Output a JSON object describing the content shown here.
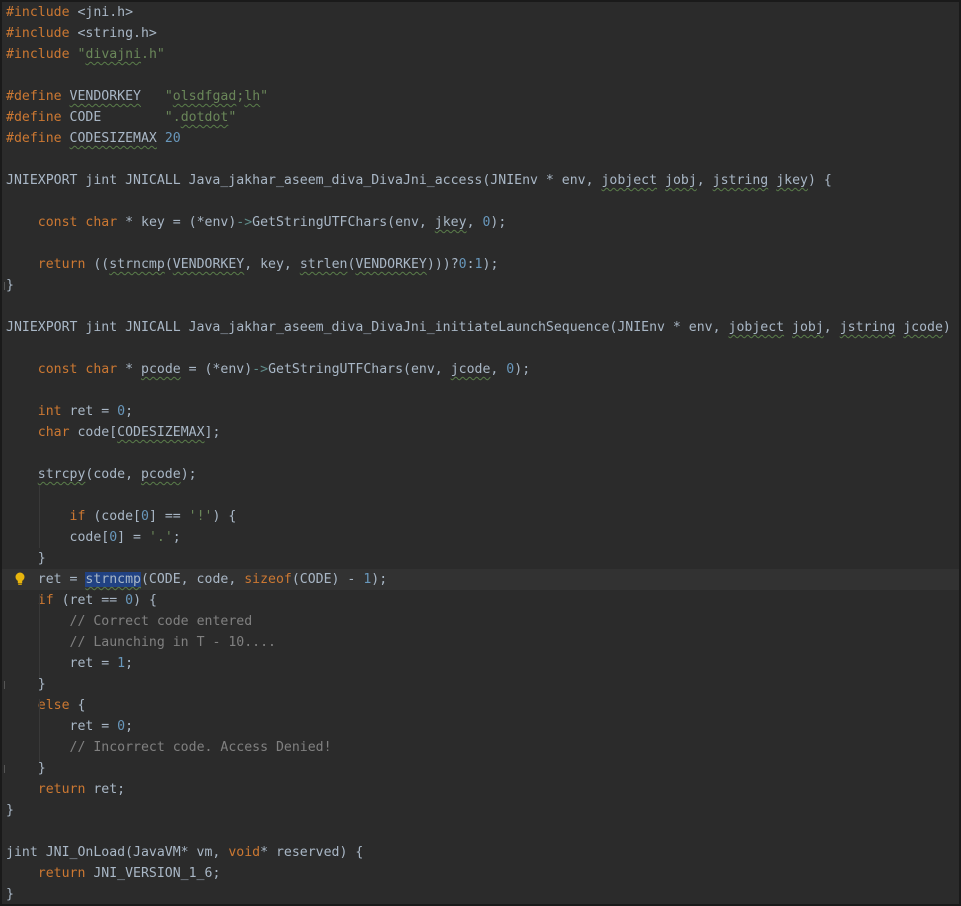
{
  "editor": {
    "lines": [
      "#include <jni.h>",
      "#include <string.h>",
      "#include \"divajni.h\"",
      "",
      "#define VENDORKEY   \"olsdfgad;lh\"",
      "#define CODE        \".dotdot\"",
      "#define CODESIZEMAX 20",
      "",
      "JNIEXPORT jint JNICALL Java_jakhar_aseem_diva_DivaJni_access(JNIEnv * env, jobject jobj, jstring jkey) {",
      "",
      "    const char * key = (*env)->GetStringUTFChars(env, jkey, 0);",
      "",
      "    return ((strncmp(VENDORKEY, key, strlen(VENDORKEY)))?0:1);",
      "}",
      "",
      "JNIEXPORT jint JNICALL Java_jakhar_aseem_diva_DivaJni_initiateLaunchSequence(JNIEnv * env, jobject jobj, jstring jcode) {",
      "",
      "    const char * pcode = (*env)->GetStringUTFChars(env, jcode, 0);",
      "",
      "    int ret = 0;",
      "    char code[CODESIZEMAX];",
      "",
      "    strcpy(code, pcode);",
      "",
      "        if (code[0] == '!') {",
      "        code[0] = '.';",
      "    }",
      "    ret = strncmp(CODE, code, sizeof(CODE) - 1);",
      "    if (ret == 0) {",
      "        // Correct code entered",
      "        // Launching in T - 10....",
      "        ret = 1;",
      "    }",
      "    else {",
      "        ret = 0;",
      "        // Incorrect code. Access Denied!",
      "    }",
      "    return ret;",
      "}",
      "",
      "jint JNI_OnLoad(JavaVM* vm, void* reserved) {",
      "    return JNI_VERSION_1_6;",
      "}"
    ],
    "current_line_index": 27,
    "colors": {
      "background": "#2b2b2b",
      "keyword": "#cc7832",
      "string": "#6a8759",
      "number": "#6897bb",
      "comment": "#808080",
      "text": "#a9b7c6",
      "selection": "#214283"
    },
    "intention_icon": "lightbulb-icon"
  }
}
